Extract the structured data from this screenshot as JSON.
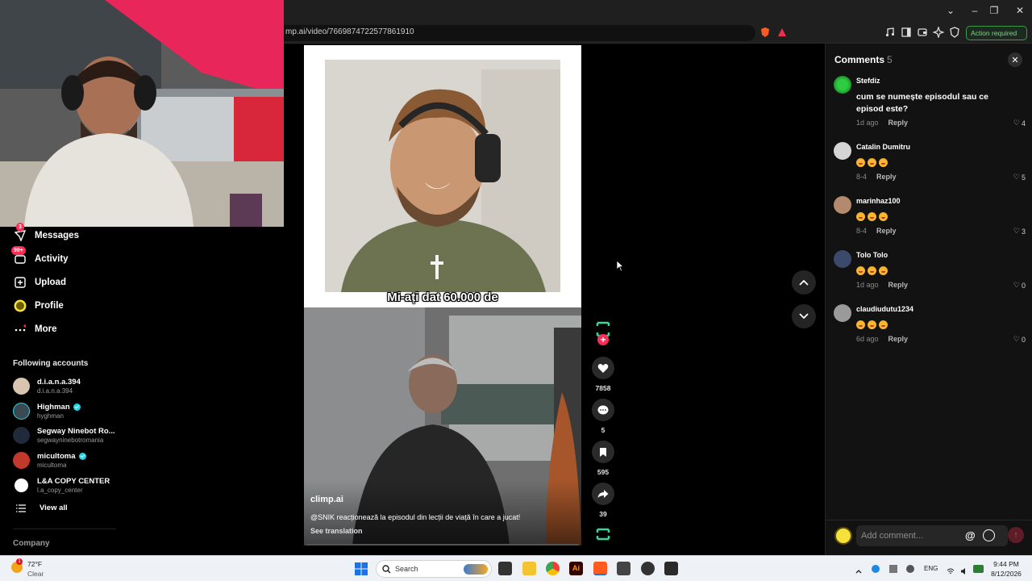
{
  "browser": {
    "url": "mp.ai/video/7669874722577861910",
    "action_required": "Action required",
    "window_controls": [
      "chevron-down-icon",
      "minimize-icon",
      "restore-icon",
      "close-icon"
    ]
  },
  "sidebar": {
    "items": [
      {
        "label": "Messages",
        "icon": "messages-icon",
        "badge": "3"
      },
      {
        "label": "Activity",
        "icon": "activity-icon",
        "badge": "99+"
      },
      {
        "label": "Upload",
        "icon": "upload-icon",
        "badge": ""
      },
      {
        "label": "Profile",
        "icon": "profile-icon",
        "badge": ""
      },
      {
        "label": "More",
        "icon": "more-icon",
        "badge": ""
      }
    ],
    "following_title": "Following accounts",
    "following": [
      {
        "name": "d.i.a.n.a.394",
        "handle": "d.i.a.n.a.394",
        "verified": false
      },
      {
        "name": "Highman",
        "handle": "hyghman",
        "verified": true
      },
      {
        "name": "Segway Ninebot Ro...",
        "handle": "segwayninebotromania",
        "verified": false
      },
      {
        "name": "micultoma",
        "handle": "micultoma",
        "verified": true
      },
      {
        "name": "L&A COPY CENTER",
        "handle": "l.a_copy_center",
        "verified": false
      }
    ],
    "view_all": "View all",
    "company": "Company"
  },
  "video": {
    "caption_text": "Mi-ați dat 60.000 de",
    "author": "climp.ai",
    "description": "@SNIK reacționează la episodul din lecții de viață în care a jucat!",
    "see_translation": "See translation",
    "likes": "7858",
    "comments": "5",
    "saves": "595",
    "shares": "39"
  },
  "comments": {
    "title": "Comments",
    "count": "5",
    "items": [
      {
        "user": "Stefdiz",
        "text": "cum se numește episodul sau ce episod este?",
        "emojis": 0,
        "time": "1d ago",
        "reply": "Reply",
        "likes": "4"
      },
      {
        "user": "Catalin Dumitru",
        "text": "",
        "emojis": 3,
        "time": "8-4",
        "reply": "Reply",
        "likes": "5"
      },
      {
        "user": "marinhaz100",
        "text": "",
        "emojis": 3,
        "time": "8-4",
        "reply": "Reply",
        "likes": "3"
      },
      {
        "user": "Tolo Tolo",
        "text": "",
        "emojis": 3,
        "time": "1d ago",
        "reply": "Reply",
        "likes": "0"
      },
      {
        "user": "claudiudutu1234",
        "text": "",
        "emojis": 3,
        "time": "6d ago",
        "reply": "Reply",
        "likes": "0"
      }
    ],
    "input_placeholder": "Add comment..."
  },
  "taskbar": {
    "weather_temp": "72°F",
    "weather_cond": "Clear",
    "weather_badge": "1",
    "search": "Search",
    "lang": "ENG",
    "time": "9:44 PM",
    "date": "8/12/2026"
  }
}
